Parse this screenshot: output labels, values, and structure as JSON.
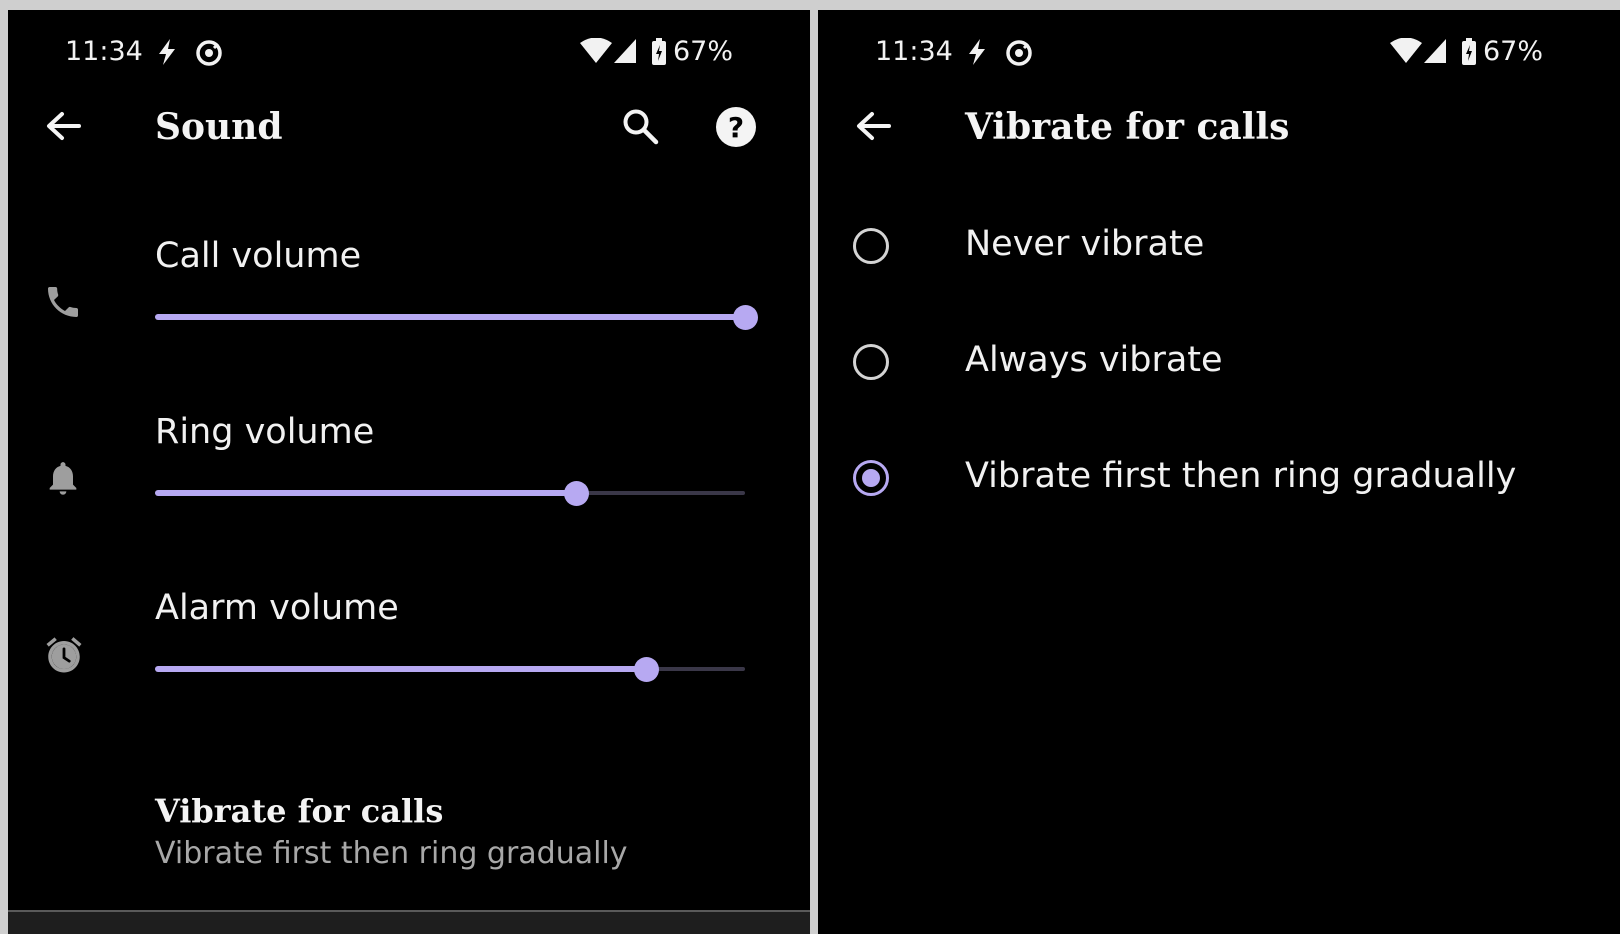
{
  "colors": {
    "accent": "#b7a9f2",
    "background": "#000000",
    "track_inactive": "#3a3748"
  },
  "status_bar": {
    "time": "11:34",
    "battery": "67%",
    "icons": [
      "charging-bolt-icon",
      "data-saver-icon",
      "wifi-icon",
      "cell-signal-icon",
      "battery-icon"
    ]
  },
  "left": {
    "title": "Sound",
    "actions": [
      "back-arrow-icon",
      "search-icon",
      "help-icon"
    ],
    "volumes": [
      {
        "label": "Call volume",
        "icon": "phone-icon",
        "level": 1.0
      },
      {
        "label": "Ring volume",
        "icon": "bell-icon",
        "level": 0.714
      },
      {
        "label": "Alarm volume",
        "icon": "alarm-clock-icon",
        "level": 0.833
      }
    ],
    "vibrate": {
      "title": "Vibrate for calls",
      "summary": "Vibrate first then ring gradually"
    }
  },
  "right": {
    "title": "Vibrate for calls",
    "options": [
      {
        "label": "Never vibrate",
        "checked": false
      },
      {
        "label": "Always vibrate",
        "checked": false
      },
      {
        "label": "Vibrate first then ring gradually",
        "checked": true
      }
    ]
  }
}
